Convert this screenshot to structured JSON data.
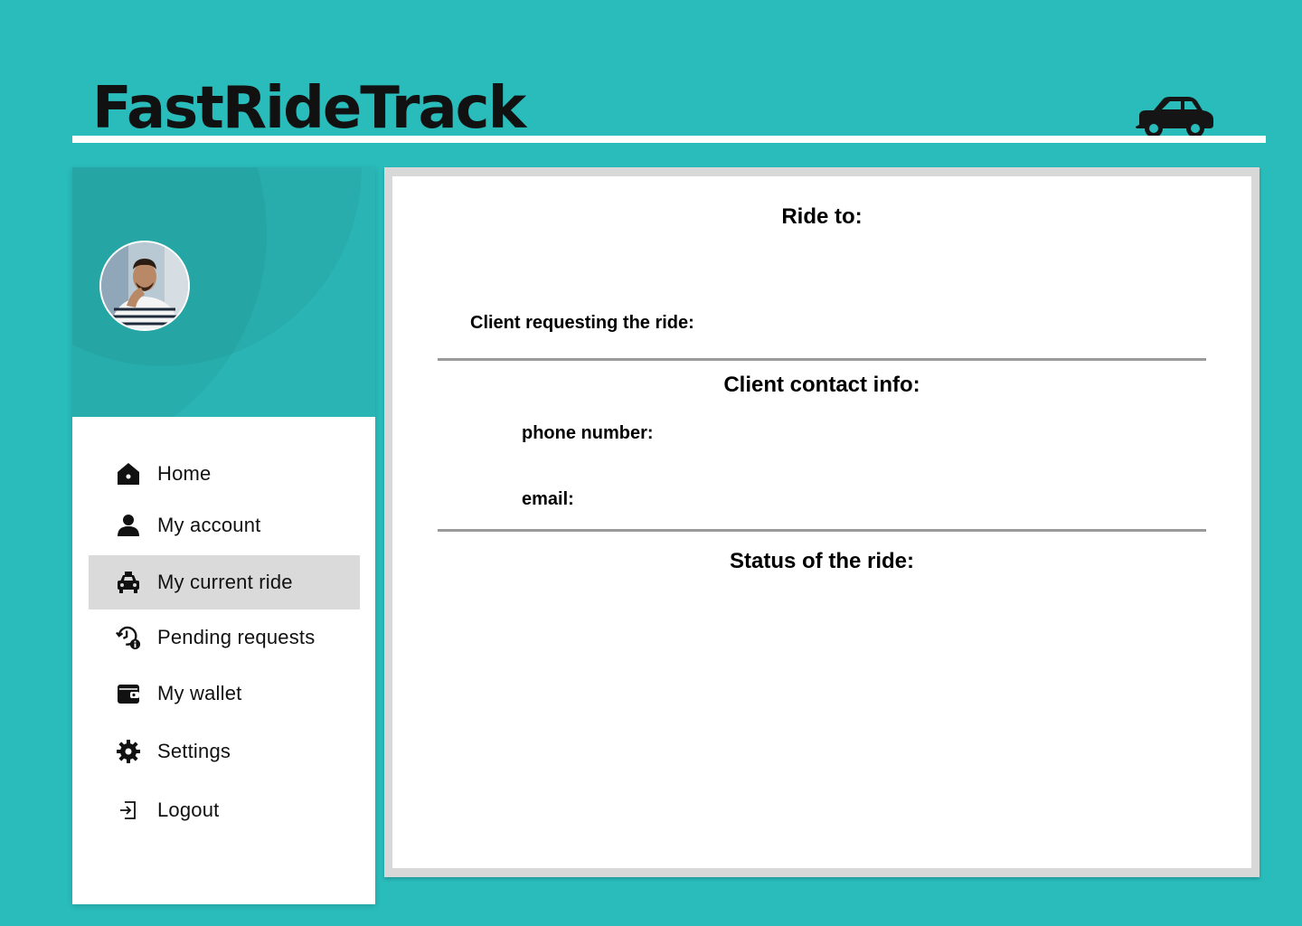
{
  "header": {
    "app_title": "FastRideTrack",
    "icon": "car-icon"
  },
  "sidebar": {
    "avatar_icon": "avatar",
    "items": [
      {
        "label": "Home",
        "icon": "home-icon",
        "active": false
      },
      {
        "label": "My account",
        "icon": "user-icon",
        "active": false
      },
      {
        "label": "My current ride",
        "icon": "taxi-icon",
        "active": true
      },
      {
        "label": "Pending requests",
        "icon": "history-info-icon",
        "active": false
      },
      {
        "label": "My wallet",
        "icon": "wallet-icon",
        "active": false
      },
      {
        "label": "Settings",
        "icon": "gear-icon",
        "active": false
      },
      {
        "label": "Logout",
        "icon": "logout-icon",
        "active": false
      }
    ]
  },
  "main": {
    "ride_to_label": "Ride to:",
    "client_requesting_label": "Client requesting the ride:",
    "contact_heading": "Client contact info:",
    "phone_label": "phone number:",
    "email_label": "email:",
    "status_heading": "Status of the ride:"
  },
  "colors": {
    "background": "#2abbbb",
    "sidebar_hero": "#2ab4b4",
    "active_item": "#dadada",
    "text": "#111111"
  }
}
